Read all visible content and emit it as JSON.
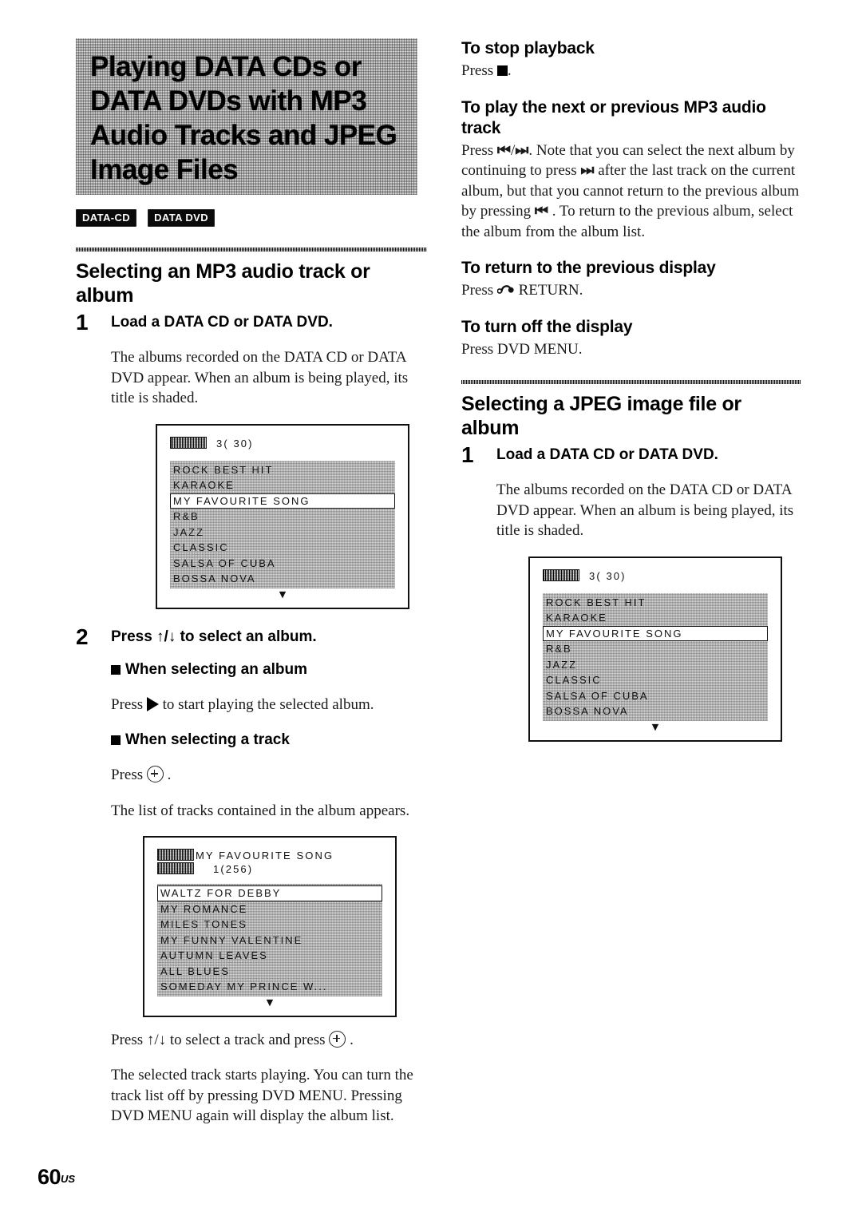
{
  "page": {
    "number": "60",
    "number_suffix": "US"
  },
  "chapter": {
    "title_lines": [
      "Playing DATA CDs or",
      "DATA DVDs with MP3",
      "Audio Tracks and JPEG",
      "Image Files"
    ],
    "badges": [
      "DATA-CD",
      "DATA DVD"
    ]
  },
  "left_column": {
    "section": {
      "heading": "Selecting an MP3 audio track or album",
      "steps": [
        {
          "number": "1",
          "title": "Load a DATA CD or DATA DVD.",
          "body": "The albums recorded on the DATA CD or DATA DVD appear. When an album is being played, its title is shaded."
        },
        {
          "number": "2",
          "title": "Press ↑/↓ to select an album."
        }
      ],
      "bullets": [
        {
          "heading": "When selecting an album",
          "body_before": "Press ",
          "body_after": " to start playing the selected album.",
          "glyph": "play-icon"
        },
        {
          "heading": "When selecting a track",
          "body_before": "Press ",
          "body_after": " .",
          "glyph": "enter-circle-icon",
          "extra_body": "The list of tracks contained in the album appears."
        }
      ],
      "closing": {
        "line1_before": "Press ↑/↓ to select a track and press ",
        "line1_after": " .",
        "rest": "The selected track starts playing. You can turn the track list off by pressing DVD MENU. Pressing DVD MENU again will display the album list."
      }
    },
    "album_screen": {
      "header_count": "3( 30)",
      "items": [
        "ROCK BEST HIT",
        "KARAOKE",
        "MY FAVOURITE SONG",
        "R&B",
        "JAZZ",
        "CLASSIC",
        "SALSA OF CUBA",
        "BOSSA NOVA"
      ],
      "selected_index": 2,
      "scroll_arrow": "▼"
    },
    "track_screen": {
      "header_title": "MY FAVOURITE SONG",
      "header_count": "1(256)",
      "items": [
        "WALTZ FOR DEBBY",
        "MY ROMANCE",
        "MILES TONES",
        "MY FUNNY VALENTINE",
        "AUTUMN LEAVES",
        "ALL BLUES",
        "SOMEDAY MY PRINCE W..."
      ],
      "selected_index": 0,
      "scroll_arrow": "▼"
    }
  },
  "right_column": {
    "topics": [
      {
        "heading": "To stop playback",
        "body_before": "Press ",
        "glyph": "stop-square-icon",
        "body_after": "."
      },
      {
        "heading": "To play the next or previous MP3 audio track",
        "body_before": "Press ",
        "glyph1": "prev-track-icon",
        "sep": "/",
        "glyph2": "next-track-icon",
        "body_mid1": ". Note that you can select the next album by continuing to press ",
        "body_mid2": " after the last track on the current album, but that you cannot return to the previous album by pressing ",
        "body_mid3": " . To return to the previous album, select the album from the album list."
      },
      {
        "heading": "To return to the previous display",
        "body_before": "Press ",
        "glyph": "return-arrow-icon",
        "body_after": " RETURN."
      },
      {
        "heading": "To turn off the display",
        "body_plain": "Press DVD MENU."
      }
    ],
    "section": {
      "heading": "Selecting a JPEG image file or album",
      "step": {
        "number": "1",
        "title": "Load a DATA CD or DATA DVD.",
        "body": "The albums recorded on the DATA CD or DATA DVD appear. When an album is being played, its title is shaded."
      }
    },
    "album_screen": {
      "header_count": "3( 30)",
      "items": [
        "ROCK BEST HIT",
        "KARAOKE",
        "MY FAVOURITE SONG",
        "R&B",
        "JAZZ",
        "CLASSIC",
        "SALSA OF CUBA",
        "BOSSA NOVA"
      ],
      "selected_index": 2,
      "scroll_arrow": "▼"
    }
  }
}
